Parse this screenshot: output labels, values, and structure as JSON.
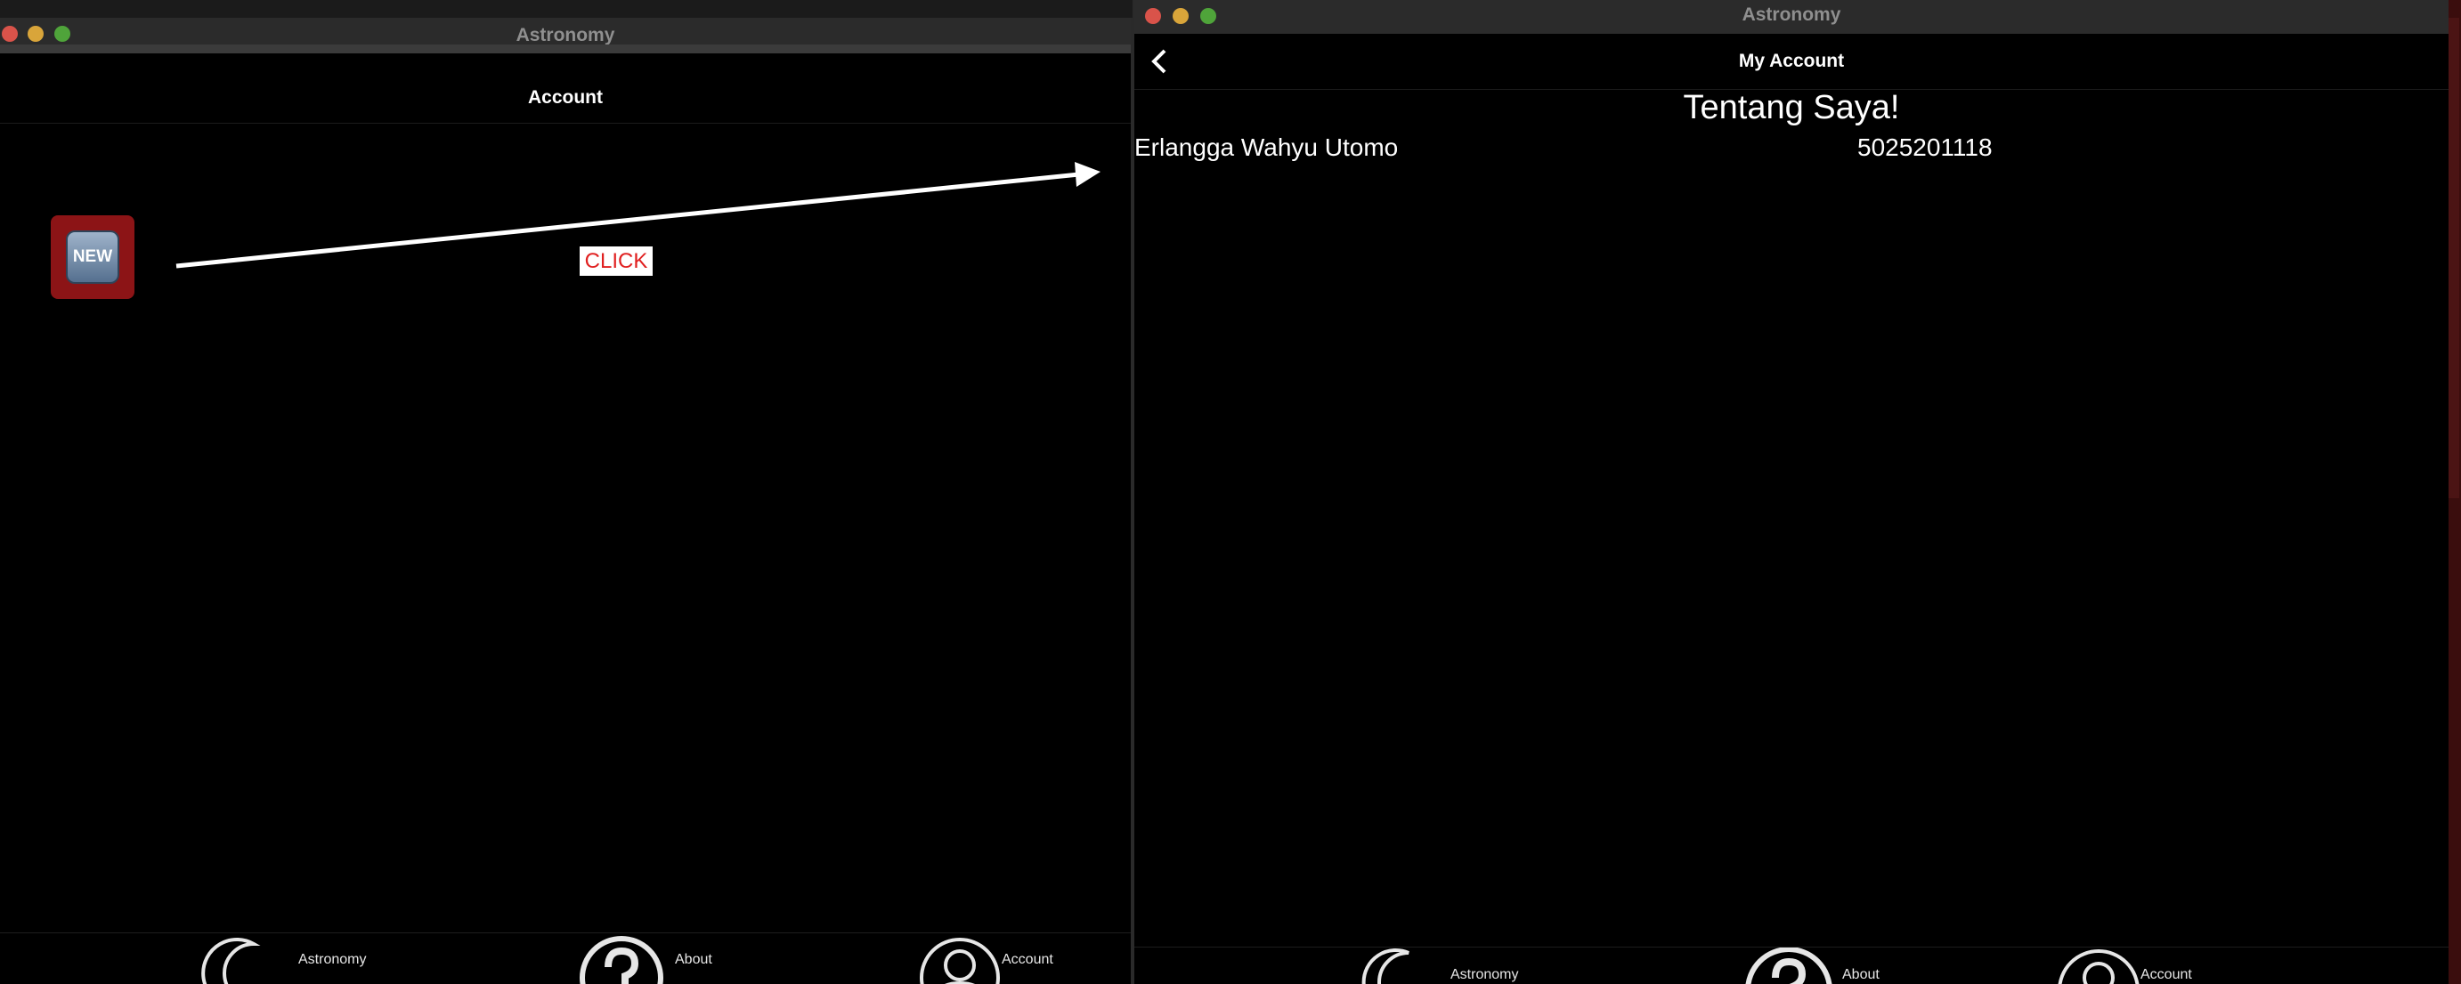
{
  "left_window": {
    "title": "Astronomy",
    "nav_title": "Account",
    "new_badge": "NEW",
    "click_label": "CLICK",
    "tabs": [
      {
        "label": "Astronomy",
        "icon": "moon-icon"
      },
      {
        "label": "About",
        "icon": "question-icon"
      },
      {
        "label": "Account",
        "icon": "person-icon"
      }
    ]
  },
  "right_window": {
    "title": "Astronomy",
    "nav_title": "My Account",
    "heading": "Tentang Saya!",
    "name": "Erlangga Wahyu Utomo",
    "id_number": "5025201118",
    "tabs": [
      {
        "label": "Astronomy",
        "icon": "moon-icon"
      },
      {
        "label": "About",
        "icon": "question-icon"
      },
      {
        "label": "Account",
        "icon": "person-icon"
      }
    ]
  },
  "colors": {
    "background": "#000000",
    "titlebar": "#2b2b2b",
    "new_tile": "#8c1416",
    "click_text": "#e02020"
  }
}
